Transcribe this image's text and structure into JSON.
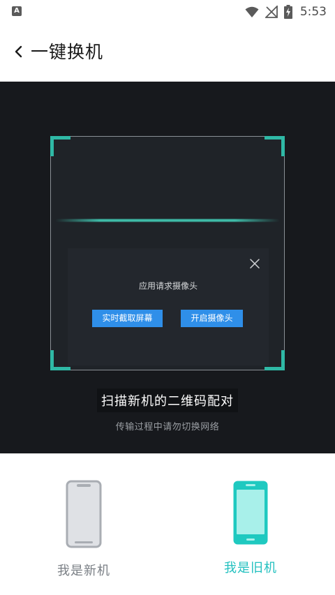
{
  "status_bar": {
    "time": "5:53",
    "icons": [
      "app-notification-icon",
      "wifi-icon",
      "no-signal-icon",
      "battery-charging-icon"
    ]
  },
  "header": {
    "title": "一键换机",
    "back_icon": "chevron-left-icon"
  },
  "scanner": {
    "dialog": {
      "message": "应用请求摄像头",
      "close_icon": "close-icon",
      "buttons": {
        "screen_capture": "实时截取屏幕",
        "open_camera": "开启摄像头"
      }
    },
    "title": "扫描新机的二维码配对",
    "subtitle": "传输过程中请勿切换网络"
  },
  "roles": {
    "new_phone": {
      "label": "我是新机",
      "selected": false
    },
    "old_phone": {
      "label": "我是旧机",
      "selected": true
    }
  },
  "colors": {
    "accent": "#22c0bf",
    "scanner_corner": "#2fb9a6",
    "dialog_button": "#2f8fe9",
    "scanner_bg": "#17191d"
  }
}
